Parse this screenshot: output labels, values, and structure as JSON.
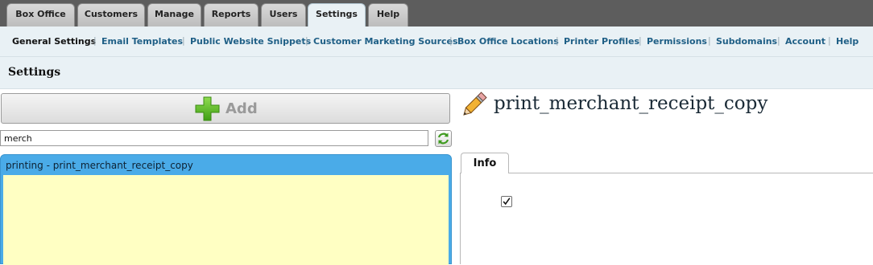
{
  "top_tabs": [
    {
      "label": "Box Office",
      "active": false
    },
    {
      "label": "Customers",
      "active": false
    },
    {
      "label": "Manage",
      "active": false
    },
    {
      "label": "Reports",
      "active": false
    },
    {
      "label": "Users",
      "active": false
    },
    {
      "label": "Settings",
      "active": true
    },
    {
      "label": "Help",
      "active": false
    }
  ],
  "subnav": [
    {
      "label": "General Settings",
      "current": true
    },
    {
      "label": "Email Templates",
      "current": false
    },
    {
      "label": "Public Website Snippets",
      "current": false
    },
    {
      "label": "Customer Marketing Sources",
      "current": false
    },
    {
      "label": "Box Office Locations",
      "current": false
    },
    {
      "label": "Printer Profiles",
      "current": false
    },
    {
      "label": "Permissions",
      "current": false
    },
    {
      "label": "Subdomains",
      "current": false
    },
    {
      "label": "Account",
      "current": false
    },
    {
      "label": "Help",
      "current": false
    }
  ],
  "subnav_separator": "|",
  "page_title": "Settings",
  "add_button": {
    "label": "Add",
    "icon": "plus-icon"
  },
  "search": {
    "value": "merch"
  },
  "refresh_icon": "refresh-icon",
  "list": {
    "items": [
      {
        "label": "printing - print_merchant_receipt_copy",
        "selected": true
      }
    ]
  },
  "detail": {
    "icon": "pencil-icon",
    "title": "print_merchant_receipt_copy",
    "tabs": [
      {
        "label": "Info",
        "active": true
      }
    ],
    "value_checked": true
  },
  "colors": {
    "topbar": "#5d5d5d",
    "nav_bg": "#e9f1f5",
    "link": "#1f5f86",
    "list_selected": "#4aabe8",
    "list_body": "#ffffc3",
    "add_plus": "#5bbf2a"
  }
}
